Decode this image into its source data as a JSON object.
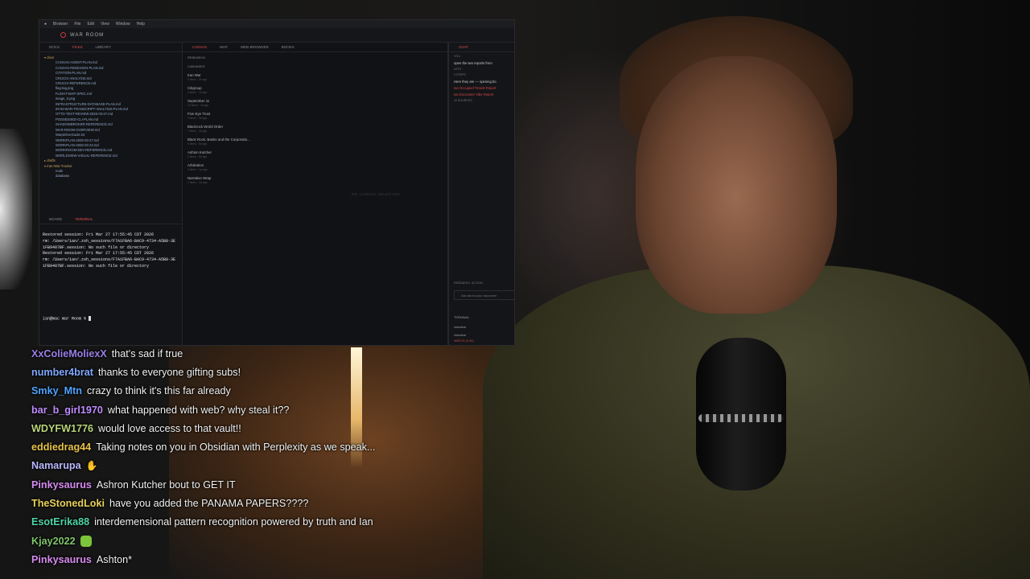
{
  "colors": {
    "accent": "#e05050",
    "link": "#d04848"
  },
  "screen": {
    "menu": [
      "Browser",
      "File",
      "Edit",
      "View",
      "Window",
      "Help"
    ],
    "title": "WAR ROOM",
    "left_tabs": [
      "DOCS",
      "FILES",
      "LIBRARY"
    ],
    "tree_root": "docs",
    "files": [
      "CANVAS-AGENT-PLAN.md",
      "CANVAS-REDESIGN-PLAN.md",
      "CITATION-PLAN.md",
      "CRUCIX-ANALYSIS.md",
      "CRUCIX-REFERENCE.md",
      "flag-tag.png",
      "FLIGHT-MAP-SPEC.md",
      "image_0.png",
      "INFRASTRUCTURE-DATABASE-PLAN.md",
      "IRAN-WAR-TRANSCRIPT-ANALYSIS-PLAN.md",
      "OTTO-TEXT-REVIEW-2026-03-27.md",
      "POSSESSED-CLI-PLAN.md",
      "SHADOWBROKER-REFERENCE.md",
      "WAR-ROOM-OVERVIEW.md",
      "WarpDriveGuide.txt",
      "WORKPLAN-2026-03-27.md",
      "WORKPLAN-2026-03-22.md",
      "WORKROOM-DEV-REFERENCE.md",
      "WORLDVIEW-VISUAL-REFERENCE.md"
    ],
    "tree_dirs": [
      "drafts",
      "Iran-War-Tracker",
      "node",
      "database"
    ],
    "term_tabs": [
      "BOARD",
      "TERMINAL"
    ],
    "terminal_lines": [
      "Restored session: Fri Mar 27 17:55:45 CDT 2026",
      "rm: /Users/ian/.zsh_sessions/F7A1FBA6-BAC9-4734-A5B8-3E",
      "1FB9487BF.session: No such file or directory",
      "Restored session: Fri Mar 27 17:55:45 CDT 2026",
      "rm: /Users/ian/.zsh_sessions/F7A1FBA6-BAC9-4734-A5B8-3E",
      "1FB9487BF.session: No such file or directory"
    ],
    "prompt": "ian@mac War Room %",
    "mid_tabs": [
      "CANVAS",
      "MAP",
      "WEB BROWSER",
      "BOOKS"
    ],
    "research_label": "RESEARCH",
    "research_sub": "CANVASES",
    "research_items": [
      {
        "title": "Iran War",
        "sub": "9 items · 2h ago"
      },
      {
        "title": "Citigroup",
        "sub": "4 items · 1d ago"
      },
      {
        "title": "September 11",
        "sub": "12 items · 2d ago"
      },
      {
        "title": "Five Eye Trust",
        "sub": "3 items · 3d ago"
      },
      {
        "title": "Blackrock World Order",
        "sub": "7 items · 4d ago"
      },
      {
        "title": "Black Rock, Banks and the Corporatio...",
        "sub": "5 items · 5d ago"
      },
      {
        "title": "Ashton Kutcher",
        "sub": "2 items · 6d ago"
      },
      {
        "title": "Arbitration",
        "sub": "4 items · 1w ago"
      },
      {
        "title": "Narrative Wrap",
        "sub": "1 items · 1w ago"
      }
    ],
    "canvas_empty": "NO CANVAS SELECTED",
    "right_tabs": [
      "CHAT"
    ],
    "chat_you_label": "YOU",
    "chat_you": "open the two reports from",
    "chat_bot_label": "LETO",
    "chat_steps": "2 STEPS",
    "chat_reply": "Here they are — opening bo",
    "chat_links": [
      "Ian Occupied Trends Report",
      "Ian Encounter Vibe Report"
    ],
    "chat_sources": "10 SOURCES",
    "chat_modes": [
      "RESEARCH",
      "ACTION"
    ],
    "ask_placeholder": "Ask about your documen",
    "rt_term_tab": "TERMINAL",
    "rt_term_lines": [
      "industrial",
      "industrial",
      "WATCH (0.00)"
    ]
  },
  "chat_messages": [
    {
      "user": "XxColieMoliexX",
      "color": "#9a7ee6",
      "text": "that's sad if true"
    },
    {
      "user": "number4brat",
      "color": "#7fa7ff",
      "text": "thanks to everyone gifting subs!"
    },
    {
      "user": "Smky_Mtn",
      "color": "#4fa3ff",
      "text": "crazy to think it's this far already"
    },
    {
      "user": "bar_b_girl1970",
      "color": "#c08cff",
      "text": "what happened with web? why steal it??"
    },
    {
      "user": "WDYFW1776",
      "color": "#b8d57a",
      "text": "would love access to that vault!!"
    },
    {
      "user": "eddiedrag44",
      "color": "#e6c34a",
      "text": "Taking notes on you in Obsidian with Perplexity as we speak..."
    },
    {
      "user": "Namarupa",
      "color": "#b8b8ff",
      "text": "",
      "emote": "hands-emote"
    },
    {
      "user": "Pinkysaurus",
      "color": "#d78cf0",
      "text": "Ashron Kutcher bout to GET IT"
    },
    {
      "user": "TheStonedLoki",
      "color": "#e8d25a",
      "text": "have you added the PANAMA PAPERS????"
    },
    {
      "user": "EsotErika88",
      "color": "#4fd4a8",
      "text": "interdemensional pattern recognition powered by truth and Ian"
    },
    {
      "user": "Kjay2022",
      "color": "#7ec46a",
      "text": "",
      "emote": "green-emote"
    },
    {
      "user": "Pinkysaurus",
      "color": "#d78cf0",
      "text": "Ashton*"
    }
  ]
}
